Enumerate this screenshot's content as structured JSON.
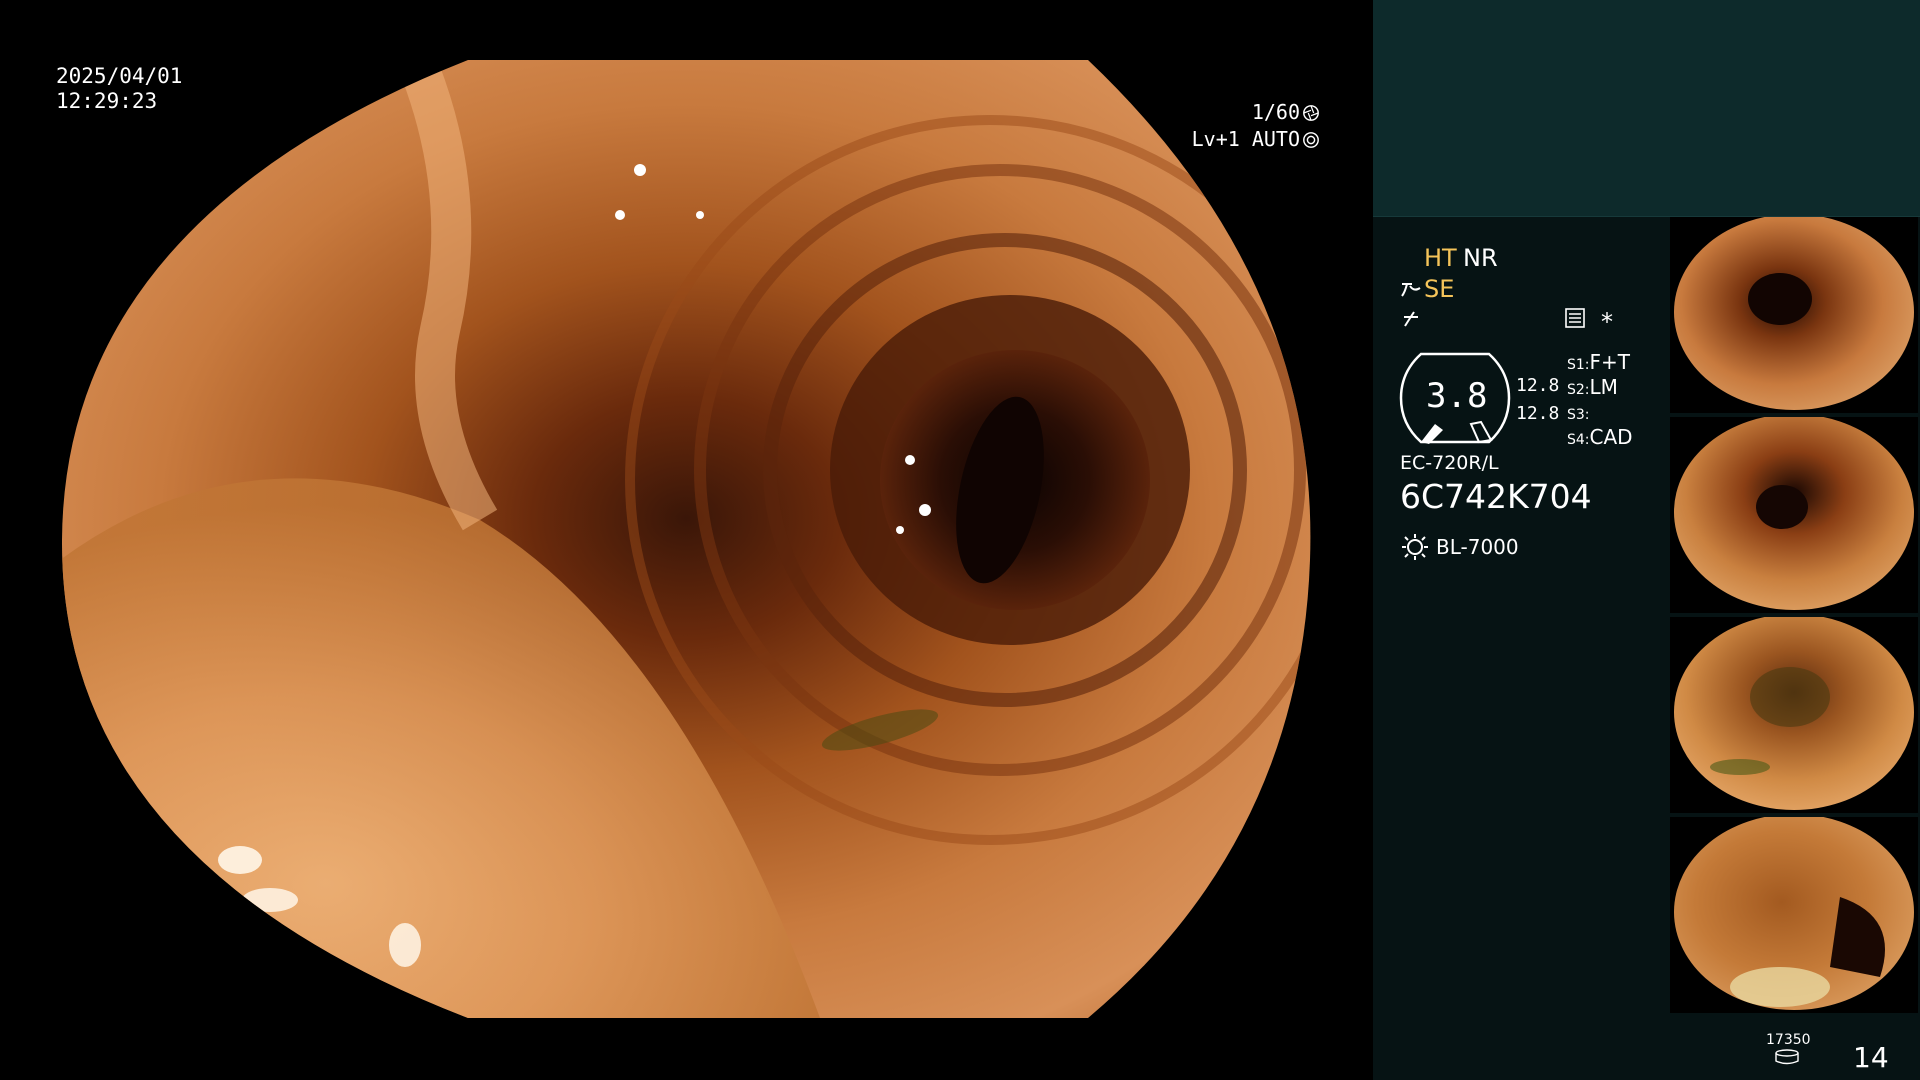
{
  "overlay": {
    "date": "2025/04/01",
    "time": "12:29:23",
    "shutter": "1/60",
    "exposure_level": "Lv+1",
    "iris_mode": "AUTO",
    "shutter_icon": "aperture-icon",
    "iris_icon": "iris-icon"
  },
  "panel": {
    "ht": "HT",
    "nr": "NR",
    "se": "SE",
    "settings_icon": "settings-list-icon",
    "asterisk": "*",
    "zoom_value": "3.8",
    "value_a": "12.8",
    "value_b": "12.8",
    "s1_label": "S1",
    "s1_value": "F+T",
    "s2_label": "S2",
    "s2_value": "LM",
    "s3_label": "S3",
    "s3_value": "",
    "s4_label": "S4",
    "s4_value": "CAD",
    "scope_model": "EC-720R/L",
    "serial": "6C742K704",
    "light_source": "BL-7000",
    "storage_count": "17350",
    "image_count": "14",
    "colors": {
      "panel_bg": "#061314",
      "panel_top_bg": "#0d2a2b",
      "accent_yellow": "#f5c45a"
    }
  },
  "thumbnails": [
    {
      "index": 1
    },
    {
      "index": 2
    },
    {
      "index": 3
    },
    {
      "index": 4
    }
  ]
}
